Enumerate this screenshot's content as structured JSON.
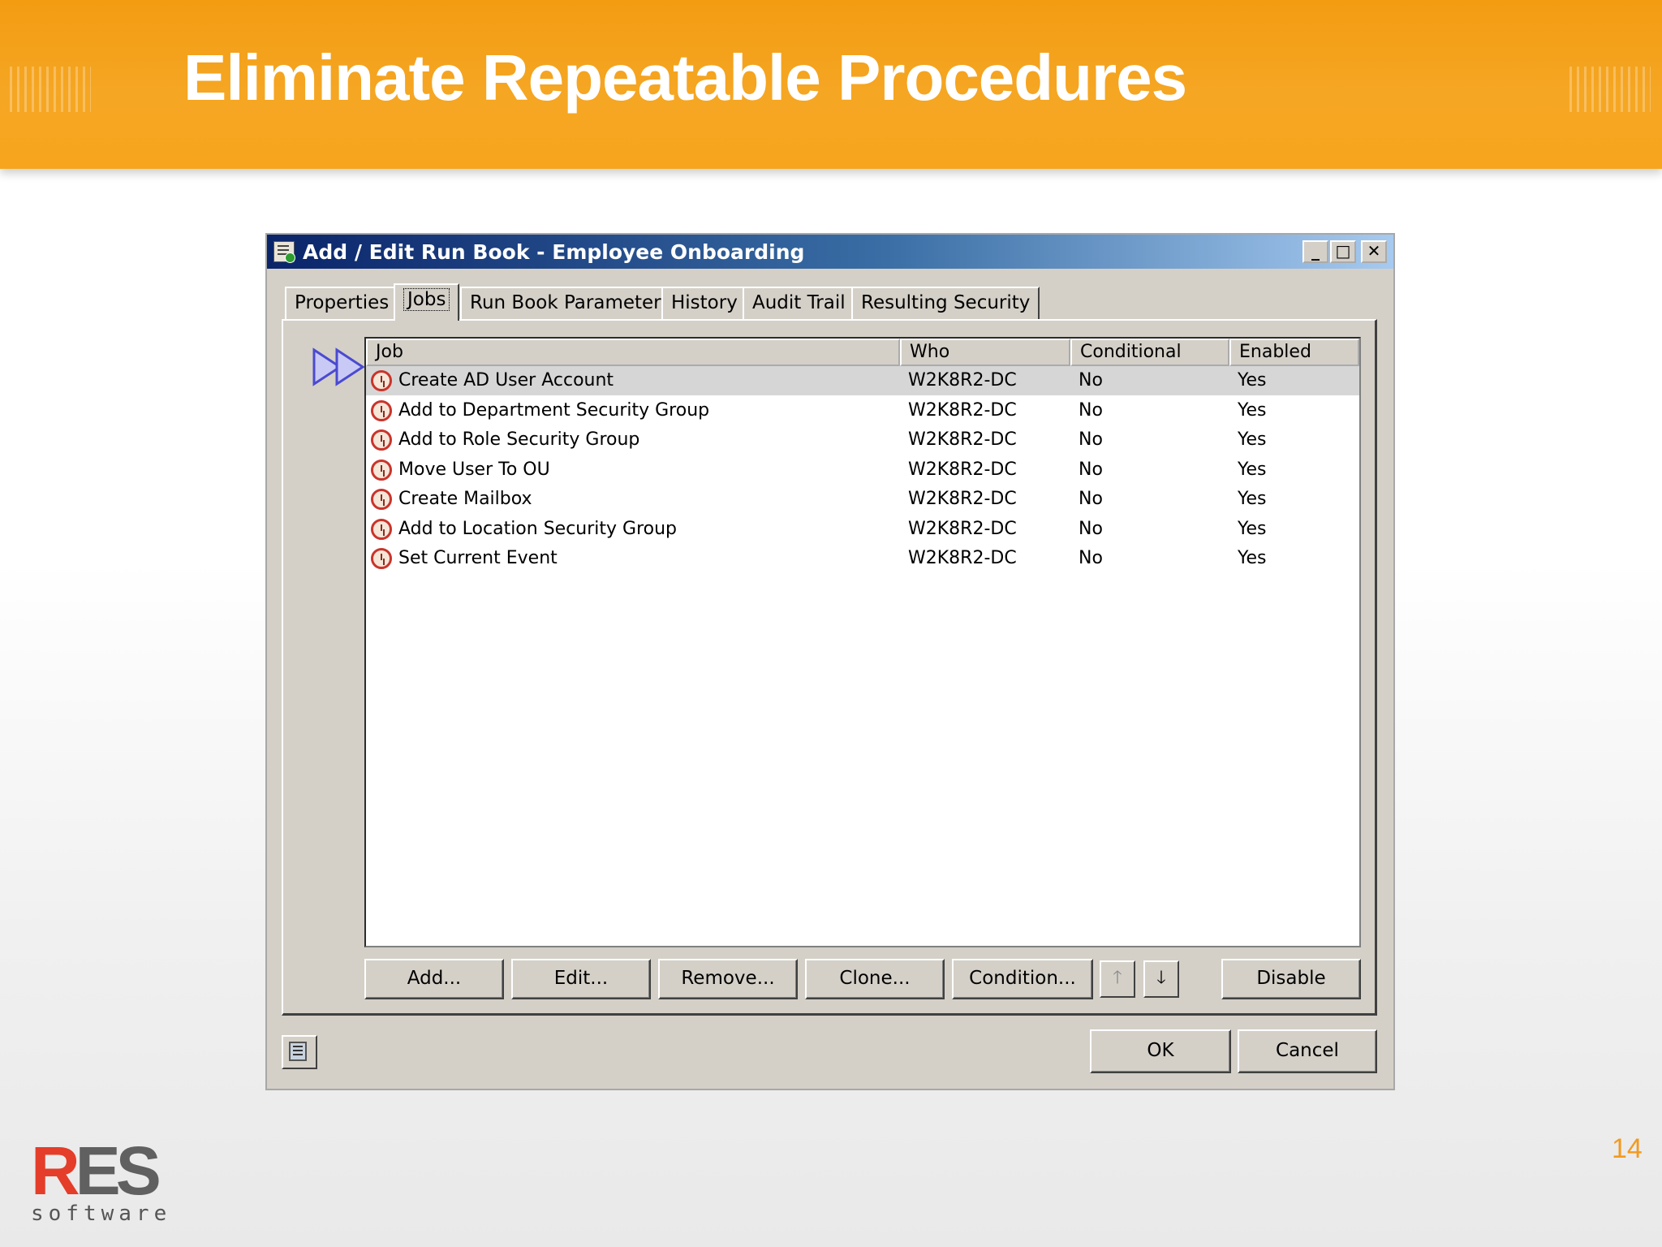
{
  "slide": {
    "title": "Eliminate Repeatable Procedures",
    "page_number": "14",
    "logo_main": "RES",
    "logo_sub": "software",
    "accent_color": "#f5a623"
  },
  "dialog": {
    "title": "Add / Edit Run Book - Employee Onboarding",
    "window_buttons": {
      "minimize": "_",
      "maximize": "□",
      "close": "✕"
    },
    "tabs": [
      {
        "label": "Properties",
        "active": false
      },
      {
        "label": "Jobs",
        "active": true
      },
      {
        "label": "Run Book Parameters",
        "active": false
      },
      {
        "label": "History",
        "active": false
      },
      {
        "label": "Audit Trail",
        "active": false
      },
      {
        "label": "Resulting Security",
        "active": false
      }
    ],
    "columns": [
      "Job",
      "Who",
      "Conditional",
      "Enabled"
    ],
    "rows": [
      {
        "job": "Create AD User Account",
        "who": "W2K8R2-DC",
        "conditional": "No",
        "enabled": "Yes",
        "selected": true
      },
      {
        "job": "Add to Department Security Group",
        "who": "W2K8R2-DC",
        "conditional": "No",
        "enabled": "Yes"
      },
      {
        "job": "Add to Role Security Group",
        "who": "W2K8R2-DC",
        "conditional": "No",
        "enabled": "Yes"
      },
      {
        "job": "Move User To OU",
        "who": "W2K8R2-DC",
        "conditional": "No",
        "enabled": "Yes"
      },
      {
        "job": "Create Mailbox",
        "who": "W2K8R2-DC",
        "conditional": "No",
        "enabled": "Yes"
      },
      {
        "job": "Add to Location Security Group",
        "who": "W2K8R2-DC",
        "conditional": "No",
        "enabled": "Yes"
      },
      {
        "job": "Set Current Event",
        "who": "W2K8R2-DC",
        "conditional": "No",
        "enabled": "Yes"
      }
    ],
    "buttons": {
      "add": "Add...",
      "edit": "Edit...",
      "remove": "Remove...",
      "clone": "Clone...",
      "condition": "Condition...",
      "move_up": "🡑",
      "move_down": "🡓",
      "disable": "Disable",
      "ok": "OK",
      "cancel": "Cancel"
    },
    "icons": {
      "app": "run-book-icon",
      "job": "job-clock-icon",
      "run": "fast-forward-icon",
      "properties": "document-icon"
    }
  }
}
